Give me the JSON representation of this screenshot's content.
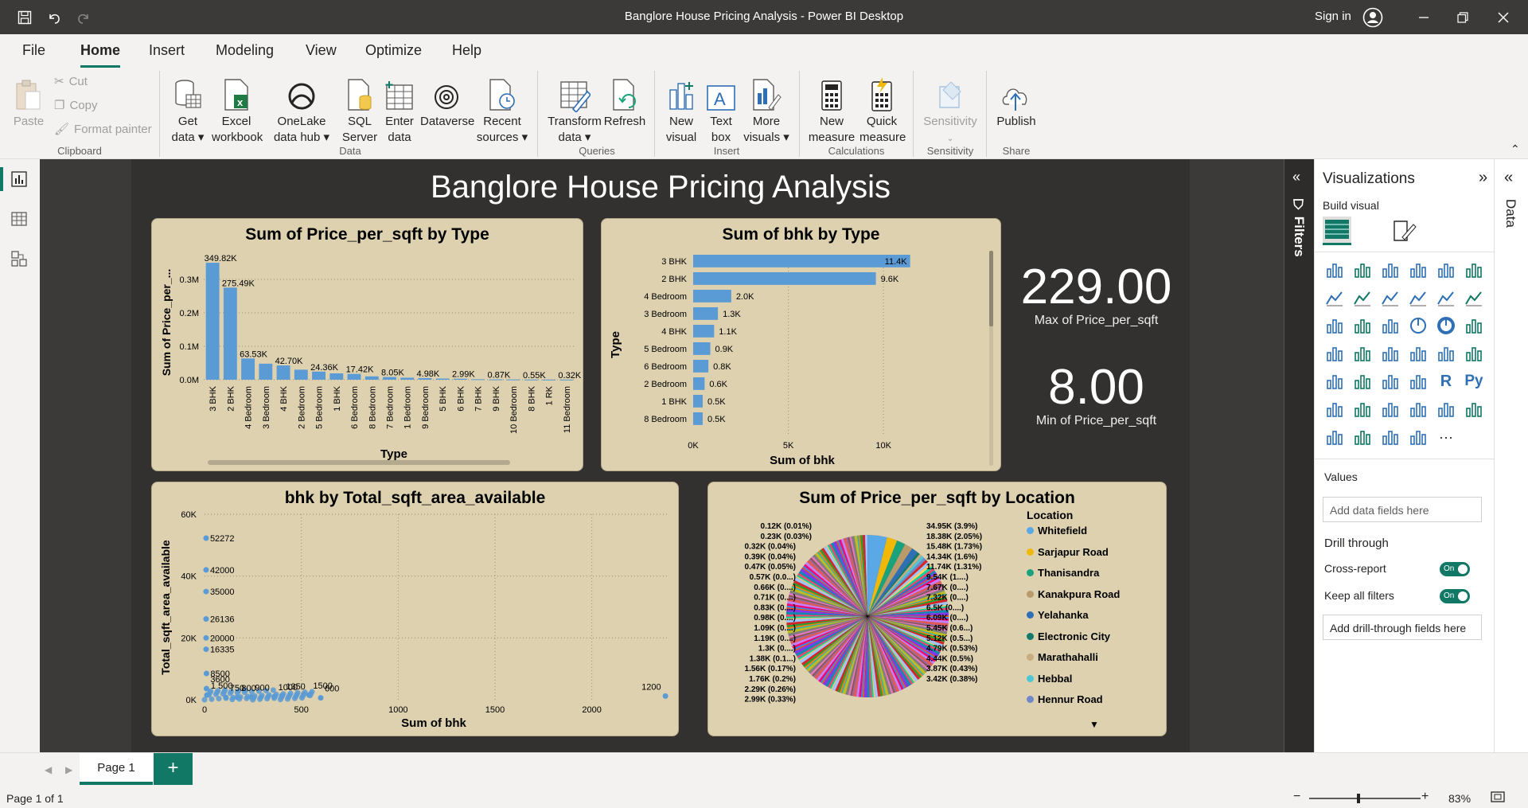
{
  "window": {
    "title": "Banglore House Pricing Analysis - Power BI Desktop",
    "signin": "Sign in"
  },
  "menu": [
    "File",
    "Home",
    "Insert",
    "Modeling",
    "View",
    "Optimize",
    "Help"
  ],
  "ribbon": {
    "paste": "Paste",
    "cut": "Cut",
    "copy": "Copy",
    "format_painter": "Format painter",
    "get_data": "Get data",
    "excel": "Excel workbook",
    "onelake": "OneLake data hub",
    "sql": "SQL Server",
    "enter_data": "Enter data",
    "dataverse": "Dataverse",
    "recent": "Recent sources",
    "transform": "Transform data",
    "refresh": "Refresh",
    "new_visual": "New visual",
    "text_box": "Text box",
    "more_visuals": "More visuals",
    "new_measure": "New measure",
    "quick_measure": "Quick measure",
    "sensitivity": "Sensitivity",
    "publish": "Publish",
    "groups": [
      "Clipboard",
      "Data",
      "Queries",
      "Insert",
      "Calculations",
      "Sensitivity",
      "Share"
    ]
  },
  "report": {
    "title": "Banglore House Pricing Analysis",
    "kpi_max": {
      "value": "229.00",
      "label": "Max of Price_per_sqft"
    },
    "kpi_min": {
      "value": "8.00",
      "label": "Min of Price_per_sqft"
    }
  },
  "chart_data": [
    {
      "type": "bar",
      "title": "Sum of Price_per_sqft by Type",
      "xlabel": "Type",
      "ylabel": "Sum of Price_per_...",
      "yticks": [
        "0.0M",
        "0.1M",
        "0.2M",
        "0.3M"
      ],
      "ylim": [
        0,
        350000
      ],
      "categories": [
        "3 BHK",
        "2 BHK",
        "4 Bedroom",
        "3 Bedroom",
        "4 BHK",
        "2 Bedroom",
        "5 Bedroom",
        "1 BHK",
        "6 Bedroom",
        "8 Bedroom",
        "7 Bedroom",
        "1 Bedroom",
        "9 Bedroom",
        "5 BHK",
        "6 BHK",
        "7 BHK",
        "9 BHK",
        "10 Bedroom",
        "8 BHK",
        "1 RK",
        "11 Bedroom"
      ],
      "values": [
        349820,
        275490,
        63530,
        48000,
        42700,
        30000,
        24360,
        19000,
        17420,
        10000,
        8050,
        6000,
        4980,
        3500,
        2990,
        1500,
        870,
        700,
        550,
        400,
        320
      ],
      "data_labels": [
        "349.82K",
        "275.49K",
        "63.53K",
        "",
        "42.70K",
        "",
        "24.36K",
        "",
        "17.42K",
        "",
        "8.05K",
        "",
        "4.98K",
        "",
        "2.99K",
        "",
        "0.87K",
        "",
        "0.55K",
        "",
        "0.32K"
      ]
    },
    {
      "type": "bar",
      "orientation": "horizontal",
      "title": "Sum of bhk by Type",
      "xlabel": "Sum of bhk",
      "ylabel": "Type",
      "xticks": [
        "0K",
        "5K",
        "10K"
      ],
      "xlim": [
        0,
        11500
      ],
      "categories": [
        "3 BHK",
        "2 BHK",
        "4 Bedroom",
        "3 Bedroom",
        "4 BHK",
        "5 Bedroom",
        "6 Bedroom",
        "2 Bedroom",
        "1 BHK",
        "8 Bedroom"
      ],
      "values": [
        11400,
        9600,
        2000,
        1300,
        1100,
        900,
        800,
        600,
        500,
        500
      ],
      "data_labels": [
        "11.4K",
        "9.6K",
        "2.0K",
        "1.3K",
        "1.1K",
        "0.9K",
        "0.8K",
        "0.6K",
        "0.5K",
        "0.5K"
      ]
    },
    {
      "type": "scatter",
      "title": "bhk by Total_sqft_area_available",
      "xlabel": "Sum of bhk",
      "ylabel": "Total_sqft_area_available",
      "xticks": [
        "0",
        "500",
        "1000",
        "1500",
        "2000"
      ],
      "yticks": [
        "0K",
        "20K",
        "40K",
        "60K"
      ],
      "xlim": [
        0,
        2400
      ],
      "ylim": [
        0,
        60000
      ],
      "points": [
        {
          "x": 8,
          "y": 52272,
          "label": "52272"
        },
        {
          "x": 8,
          "y": 42000,
          "label": "42000"
        },
        {
          "x": 8,
          "y": 35000,
          "label": "35000"
        },
        {
          "x": 8,
          "y": 26136,
          "label": "26136"
        },
        {
          "x": 8,
          "y": 20000,
          "label": "20000"
        },
        {
          "x": 8,
          "y": 16335,
          "label": "16335"
        },
        {
          "x": 10,
          "y": 8500,
          "label": "8500"
        },
        {
          "x": 10,
          "y": 3600,
          "label": "3600"
        },
        {
          "x": 12,
          "y": 1500,
          "label": "1 500"
        },
        {
          "x": 170,
          "y": 800,
          "label": "800"
        },
        {
          "x": 110,
          "y": 750,
          "label": "750"
        },
        {
          "x": 240,
          "y": 900,
          "label": "900"
        },
        {
          "x": 360,
          "y": 1000,
          "label": "1000"
        },
        {
          "x": 400,
          "y": 1350,
          "label": "1350"
        },
        {
          "x": 540,
          "y": 1500,
          "label": "1500"
        },
        {
          "x": 600,
          "y": 600,
          "label": "600"
        },
        {
          "x": 2380,
          "y": 1200,
          "label": "1200"
        }
      ]
    },
    {
      "type": "pie",
      "title": "Sum of Price_per_sqft by Location",
      "legend_title": "Location",
      "legend": [
        {
          "name": "Whitefield",
          "color": "#5aa9e6"
        },
        {
          "name": "Sarjapur  Road",
          "color": "#f2b807"
        },
        {
          "name": "Thanisandra",
          "color": "#1aa37a"
        },
        {
          "name": "Kanakpura Road",
          "color": "#b99a6b"
        },
        {
          "name": "Yelahanka",
          "color": "#2e6fb5"
        },
        {
          "name": "Electronic City",
          "color": "#127a6b"
        },
        {
          "name": "Marathahalli",
          "color": "#c8ad80"
        },
        {
          "name": "Hebbal",
          "color": "#4fc6d6"
        },
        {
          "name": "Hennur Road",
          "color": "#6f88c9"
        }
      ],
      "labels_right": [
        "34.95K (3.9%)",
        "18.38K (2.05%)",
        "15.48K (1.73%)",
        "14.34K (1.6%)",
        "11.74K (1.31%)",
        "9.54K (1....)",
        "7.67K (0....)",
        "7.32K (0....)",
        "6.5K (0....)",
        "6.09K (0....)",
        "5.45K (0.6...)",
        "5.12K (0.5...)",
        "4.79K (0.53%)",
        "4.44K (0.5%)",
        "3.87K (0.43%)",
        "3.42K (0.38%)"
      ],
      "labels_left": [
        "0.12K (0.01%)",
        "0.23K (0.03%)",
        "0.32K (0.04%)",
        "0.39K (0.04%)",
        "0.47K (0.05%)",
        "0.57K (0.0...)",
        "0.66K (0....)",
        "0.71K (0....)",
        "0.83K (0....)",
        "0.98K (0....)",
        "1.09K (0....)",
        "1.19K (0....)",
        "1.3K (0....)",
        "1.38K (0.1...)",
        "1.56K (0.17%)",
        "1.76K (0.2%)",
        "2.29K (0.26%)",
        "2.99K (0.33%)"
      ]
    }
  ],
  "visualizations": {
    "title": "Visualizations",
    "build_visual": "Build visual",
    "values_label": "Values",
    "add_data": "Add data fields here",
    "drill_through": "Drill through",
    "cross_report": "Cross-report",
    "keep_filters": "Keep all filters",
    "toggle_on": "On",
    "add_drill": "Add drill-through fields here"
  },
  "filters_label": "Filters",
  "data_label": "Data",
  "tabs": {
    "page1": "Page 1"
  },
  "status": {
    "page": "Page 1 of 1",
    "zoom": "83%"
  }
}
